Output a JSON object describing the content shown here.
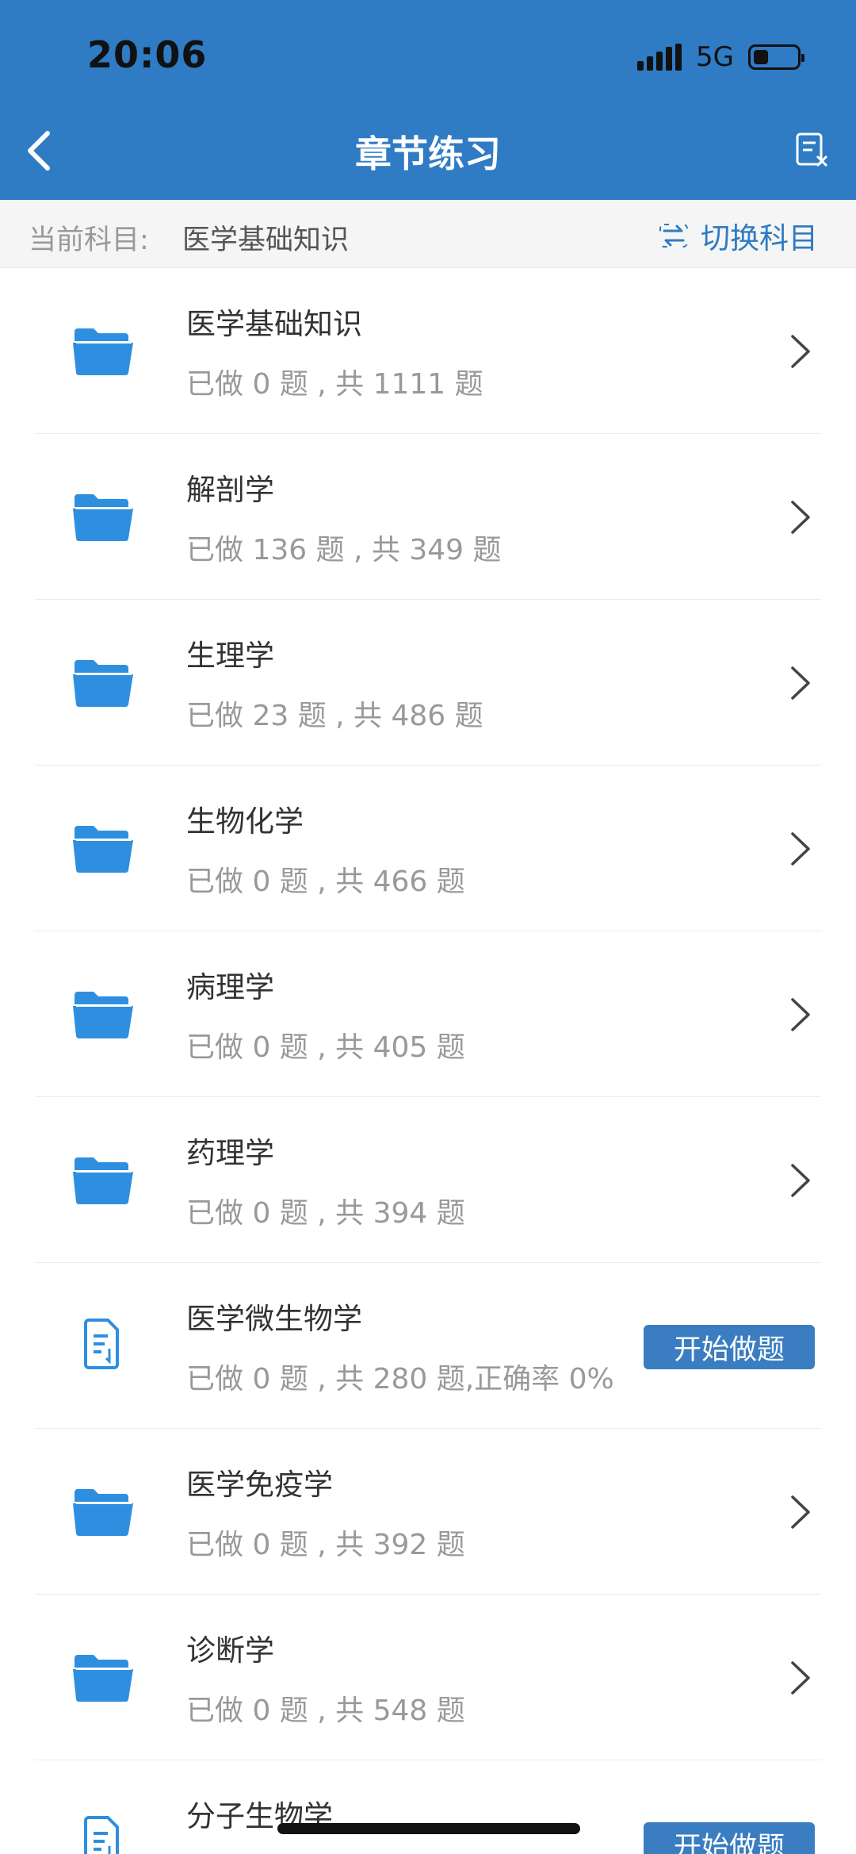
{
  "status": {
    "time": "20:06",
    "network": "5G"
  },
  "nav": {
    "title": "章节练习"
  },
  "subject": {
    "label": "当前科目:",
    "name": "医学基础知识",
    "switch_label": "切换科目"
  },
  "items": [
    {
      "title": "医学基础知识",
      "subtitle": "已做 0 题 , 共 1111 题",
      "icon": "folder-icon",
      "action": "chevron"
    },
    {
      "title": "解剖学",
      "subtitle": "已做 136 题 , 共 349 题",
      "icon": "folder-icon",
      "action": "chevron"
    },
    {
      "title": "生理学",
      "subtitle": "已做 23 题 , 共 486 题",
      "icon": "folder-icon",
      "action": "chevron"
    },
    {
      "title": "生物化学",
      "subtitle": "已做 0 题 , 共 466 题",
      "icon": "folder-icon",
      "action": "chevron"
    },
    {
      "title": "病理学",
      "subtitle": "已做 0 题 , 共 405 题",
      "icon": "folder-icon",
      "action": "chevron"
    },
    {
      "title": "药理学",
      "subtitle": "已做 0 题 , 共 394 题",
      "icon": "folder-icon",
      "action": "chevron"
    },
    {
      "title": "医学微生物学",
      "subtitle": "已做 0 题 , 共 280 题,正确率 0%",
      "icon": "document-icon",
      "action": "start",
      "action_label": "开始做题"
    },
    {
      "title": "医学免疫学",
      "subtitle": "已做 0 题 , 共 392 题",
      "icon": "folder-icon",
      "action": "chevron"
    },
    {
      "title": "诊断学",
      "subtitle": "已做 0 题 , 共 548 题",
      "icon": "folder-icon",
      "action": "chevron"
    },
    {
      "title": "分子生物学",
      "subtitle": "",
      "icon": "document-icon",
      "action": "start",
      "action_label": "开始做题"
    }
  ],
  "colors": {
    "primary": "#2F7BC4",
    "folder": "#2E8FE0",
    "button": "#3A7DC0"
  }
}
